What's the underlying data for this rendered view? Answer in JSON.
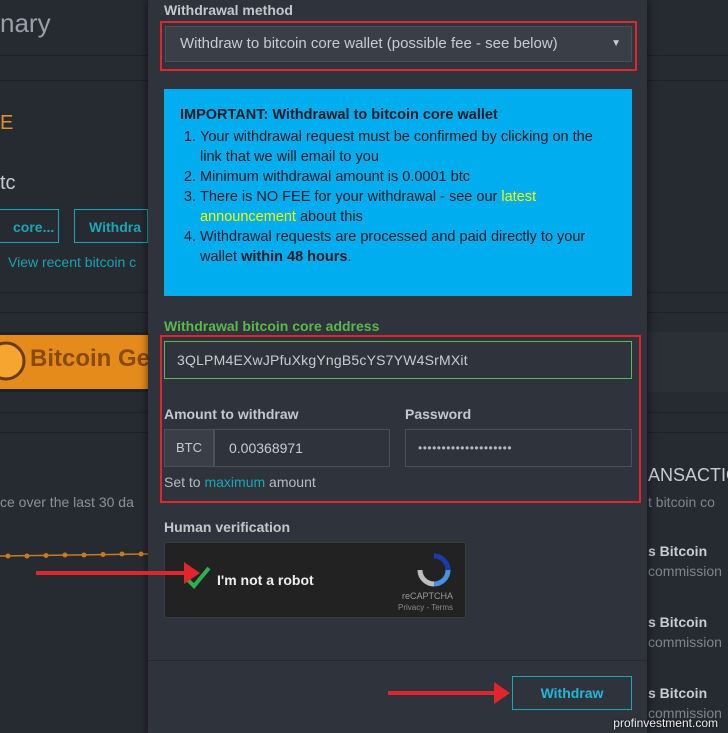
{
  "background": {
    "page_title": "nary",
    "accent_text": "E",
    "balance_unit": "tc",
    "button_left": "core...",
    "button_right": "Withdra",
    "recent_link": "View recent bitcoin c",
    "banner_text": "Bitcoin Ge",
    "price_text": "ce over the last 30 da",
    "transactions_title": "ANSACTIO",
    "transactions_sub": "t bitcoin co",
    "transactions": [
      {
        "title": "s Bitcoin",
        "sub": "commission"
      },
      {
        "title": "s Bitcoin",
        "sub": "commission"
      },
      {
        "title": "s Bitcoin",
        "sub": "commission"
      }
    ]
  },
  "modal": {
    "method_label": "Withdrawal method",
    "method_value": "Withdraw to bitcoin core wallet (possible fee - see below)",
    "info": {
      "heading": "IMPORTANT: Withdrawal to bitcoin core wallet",
      "item1": "Your withdrawal request must be confirmed by clicking on the link that we will email to you",
      "item2": "Minimum withdrawal amount is 0.0001 btc",
      "item3_pre": "There is NO FEE for your withdrawal - see our ",
      "item3_link": "latest announcement",
      "item3_post": " about this",
      "item4_pre": "Withdrawal requests are processed and paid directly to your wallet ",
      "item4_bold": "within 48 hours",
      "item4_post": "."
    },
    "address_label": "Withdrawal bitcoin core address",
    "address_value": "3QLPM4EXwJPfuXkgYngB5cYS7YW4SrMXit",
    "amount_label": "Amount to withdraw",
    "amount_prefix": "BTC",
    "amount_value": "0.00368971",
    "password_label": "Password",
    "password_value": "••••••••••••••••••••",
    "set_to": "Set to",
    "maximum": "maximum",
    "amount_word": "amount",
    "verification_label": "Human verification",
    "captcha_text": "I'm not a robot",
    "captcha_brand": "reCAPTCHA",
    "captcha_terms": "Privacy - Terms",
    "withdraw_button": "Withdraw"
  },
  "watermark": "profinvestment.com",
  "colors": {
    "accent": "#1aa6b7",
    "highlight": "#e1252c",
    "info_bg": "#00aef0",
    "success": "#5ab94a"
  }
}
